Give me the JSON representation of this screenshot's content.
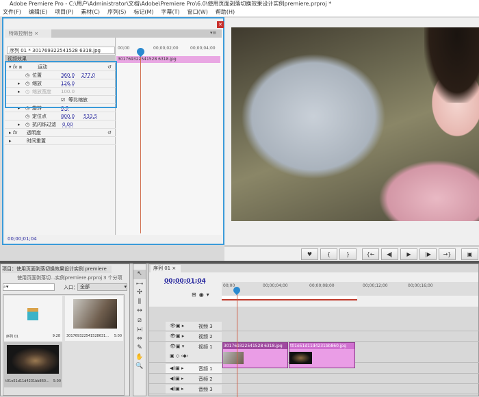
{
  "app": {
    "logo": "Pr",
    "title": "Adobe Premiere Pro - C:\\用户\\Administrator\\文档\\Adobe\\Premiere Pro\\6.0\\使用页面剥落切换效果设计实例premiere.prproj *"
  },
  "menu": [
    "文件(F)",
    "编辑(E)",
    "项目(P)",
    "素材(C)",
    "序列(S)",
    "标记(M)",
    "字幕(T)",
    "窗口(W)",
    "帮助(H)"
  ],
  "effect_controls": {
    "tab": "特效控制台 ×",
    "sequence": "序列 01 * 301769322541528 6318.jpg",
    "section": "视频效果",
    "motion": "运动",
    "position": {
      "label": "位置",
      "x": "360.0",
      "y": "277.0"
    },
    "scale": {
      "label": "缩放",
      "value": "126.0"
    },
    "scale_width": {
      "label": "缩放宽度",
      "value": "100.0"
    },
    "uniform_scale": "等比缩放",
    "rotation": {
      "label": "旋转",
      "value": "0.0"
    },
    "anchor": {
      "label": "定位点",
      "x": "800.0",
      "y": "533.5"
    },
    "antiflicker": {
      "label": "抗闪烁过滤",
      "value": "0.00"
    },
    "opacity": "透明度",
    "time_remap": "时间重置",
    "ruler": [
      "00;00",
      "00;00;02;00",
      "00;00;04;00"
    ],
    "clip": "301769322541528 6318.jpg",
    "timecode": "00;00;01;04"
  },
  "monitor_controls": [
    "♥",
    "{",
    "}",
    "{←",
    "◀|",
    "▶",
    "|▶",
    "→}",
    "▣"
  ],
  "project": {
    "title": "项目：使用页面剥落切换效果设计实例 premiere",
    "file": "使用页面剥落切...实例premiere.prproj",
    "count": "3 个分项",
    "search_placeholder": "",
    "entry_label": "入口：",
    "entry_value": "全部",
    "items": [
      {
        "name": "序列 01",
        "duration": "9:28"
      },
      {
        "name": "301769322541528631...",
        "duration": "5:00"
      },
      {
        "name": "t01e51d11d4231bb860...",
        "duration": "5:00"
      }
    ]
  },
  "tools": [
    "↖",
    "⇤⇥",
    "✣",
    "⫼",
    "↔",
    "⧄",
    "|↔|",
    "⇔",
    "✎",
    "✋",
    "🔍"
  ],
  "timeline": {
    "tab": "序列 01 ×",
    "timecode": "00;00;01;04",
    "ruler": [
      "00;00",
      "00;00;04;00",
      "00;00;08;00",
      "00;00;12;00",
      "00;00;16;00"
    ],
    "tracks": [
      "视频 3",
      "视频 2",
      "视频 1",
      "音频 1",
      "音频 2",
      "音频 3"
    ],
    "clips": [
      "301769322541528 6318.jpg",
      "t01e51d11d4231bb860.jpg"
    ]
  }
}
